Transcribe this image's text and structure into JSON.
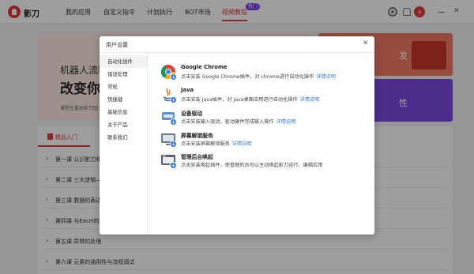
{
  "app": {
    "name": "影刀"
  },
  "nav": [
    {
      "label": "我的应用"
    },
    {
      "label": "自定义指令"
    },
    {
      "label": "计划执行"
    },
    {
      "label": "BOT市场"
    },
    {
      "label": "视频教程",
      "badge": "热门"
    }
  ],
  "user": {
    "avatar_letter": "a"
  },
  "banner": {
    "title": "机器人流程",
    "big": "改变你",
    "small": "课程主要由影刀团",
    "right_top": "发",
    "right_bottom": "性"
  },
  "course": {
    "tab_label": "精品入门",
    "lessons": [
      "第一课 认识影刀和",
      "第二课 三大逻辑—",
      "第三课 数据的表达",
      "第四课 与Excel的",
      "第五课 异常的处理",
      "第六课 元素的通用性与流程调试"
    ]
  },
  "dialog": {
    "title": "用户设置",
    "menu": [
      "自动化插件",
      "错误处理",
      "常规",
      "快捷键",
      "基础信息",
      "关于产品",
      "联系我们"
    ],
    "active_menu": "自动化插件",
    "plugins": [
      {
        "name": "Google Chrome",
        "desc": "点击安装 Google Chrome插件，对 chrome进行自动化操作",
        "link": "详情说明",
        "icon": "chrome-icon"
      },
      {
        "name": "Java",
        "desc": "点击安装 Java插件，对 Java桌面应用进行自动化操作",
        "link": "详情说明",
        "icon": "java-icon"
      },
      {
        "name": "设备驱动",
        "desc": "点击安装输入驱动，驱动硬件完成输入操作",
        "link": "详情说明",
        "icon": "driver-icon"
      },
      {
        "name": "屏幕解锁服务",
        "desc": "点击安装屏幕解锁服务",
        "link": "详情说明",
        "icon": "screen-unlock-icon"
      },
      {
        "name": "管理后台唤起",
        "desc": "点击安装唤起插件，使管理后台可以主动唤起影刀运行、编辑应用",
        "link": "",
        "icon": "console-icon"
      }
    ]
  },
  "colors": {
    "accent": "#e03a3a",
    "link": "#2f7bd9",
    "badge": "#7a3cf0"
  }
}
